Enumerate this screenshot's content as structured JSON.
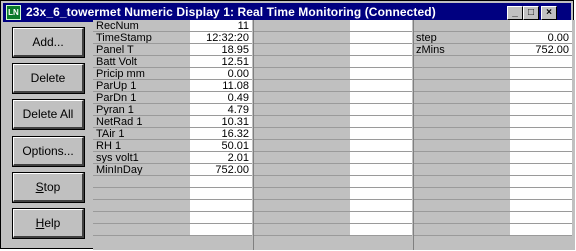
{
  "window": {
    "title": "23x_6_towermet Numeric Display 1: Real Time Monitoring (Connected)",
    "icon_name": "loggernet-app-icon"
  },
  "buttons": {
    "add": "Add...",
    "delete": "Delete",
    "delete_all": "Delete All",
    "options": "Options...",
    "stop": "Stop",
    "help": "Help"
  },
  "table1": [
    {
      "label": "RecNum",
      "value": "11"
    },
    {
      "label": "TimeStamp",
      "value": "12:32:20"
    },
    {
      "label": "Panel T",
      "value": "18.95"
    },
    {
      "label": "Batt Volt",
      "value": "12.51"
    },
    {
      "label": "Pricip mm",
      "value": "0.00"
    },
    {
      "label": "ParUp 1",
      "value": "11.08"
    },
    {
      "label": "ParDn 1",
      "value": "0.49"
    },
    {
      "label": "Pyran 1",
      "value": "4.79"
    },
    {
      "label": "NetRad 1",
      "value": "10.31"
    },
    {
      "label": "TAir 1",
      "value": "16.32"
    },
    {
      "label": "RH 1",
      "value": "50.01"
    },
    {
      "label": "sys volt1",
      "value": "2.01"
    },
    {
      "label": "MinInDay",
      "value": "752.00"
    },
    {
      "label": "",
      "value": ""
    },
    {
      "label": "",
      "value": ""
    },
    {
      "label": "",
      "value": ""
    },
    {
      "label": "",
      "value": ""
    },
    {
      "label": "",
      "value": ""
    }
  ],
  "table3": [
    {
      "label": "",
      "value": ""
    },
    {
      "label": "step",
      "value": "0.00"
    },
    {
      "label": "zMins",
      "value": "752.00"
    },
    {
      "label": "",
      "value": ""
    },
    {
      "label": "",
      "value": ""
    },
    {
      "label": "",
      "value": ""
    },
    {
      "label": "",
      "value": ""
    },
    {
      "label": "",
      "value": ""
    },
    {
      "label": "",
      "value": ""
    },
    {
      "label": "",
      "value": ""
    },
    {
      "label": "",
      "value": ""
    },
    {
      "label": "",
      "value": ""
    },
    {
      "label": "",
      "value": ""
    },
    {
      "label": "",
      "value": ""
    },
    {
      "label": "",
      "value": ""
    },
    {
      "label": "",
      "value": ""
    },
    {
      "label": "",
      "value": ""
    },
    {
      "label": "",
      "value": ""
    }
  ]
}
